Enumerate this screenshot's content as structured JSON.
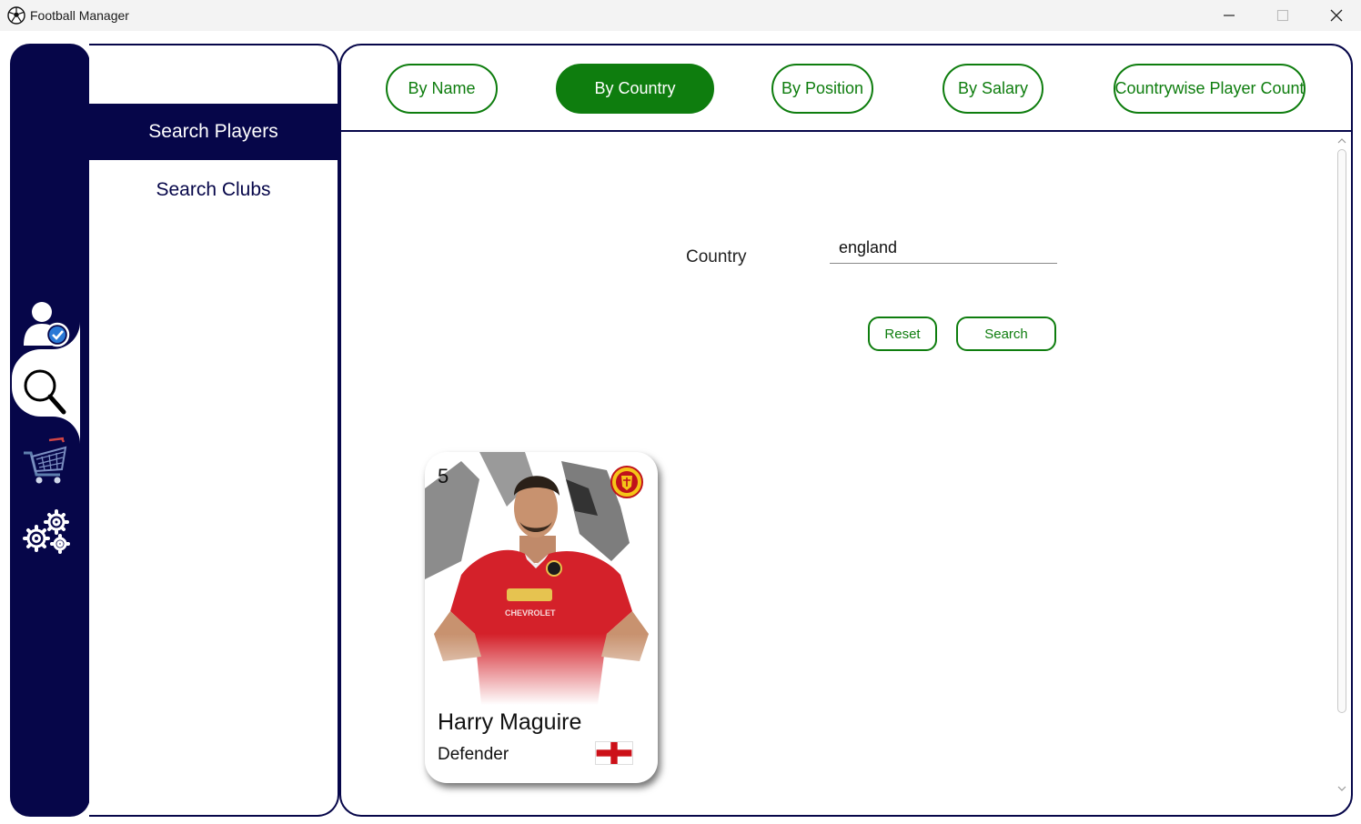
{
  "window": {
    "title": "Football Manager"
  },
  "nav": {
    "items": [
      {
        "label": "Search Players",
        "active": true
      },
      {
        "label": "Search Clubs",
        "active": false
      }
    ]
  },
  "tabs": [
    {
      "label": "By Name",
      "active": false
    },
    {
      "label": "By Country",
      "active": true
    },
    {
      "label": "By Position",
      "active": false
    },
    {
      "label": "By Salary",
      "active": false
    },
    {
      "label": "Countrywise Player Count",
      "active": false
    }
  ],
  "form": {
    "country_label": "Country",
    "country_value": "england",
    "reset_label": "Reset",
    "search_label": "Search"
  },
  "results": [
    {
      "number": "5",
      "name": "Harry Maguire",
      "position": "Defender",
      "club_badge_icon": "manchester-united-badge",
      "flag_icon": "england-flag"
    }
  ],
  "colors": {
    "navy": "#060649",
    "green": "#0e7d0e"
  }
}
